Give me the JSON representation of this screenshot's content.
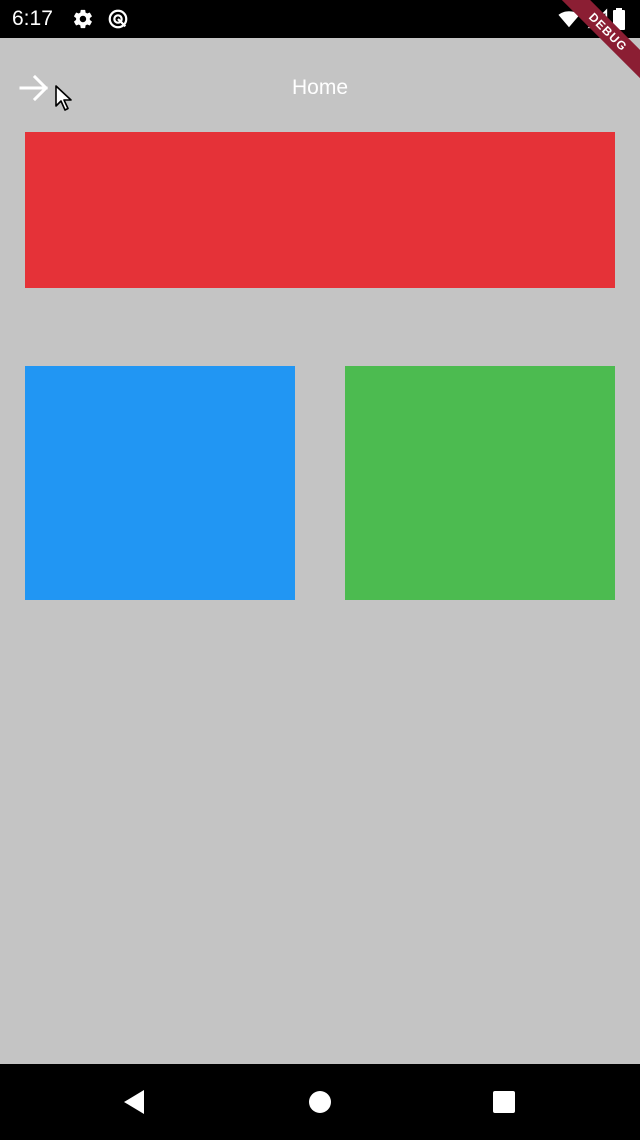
{
  "status_bar": {
    "time": "6:17",
    "icons": [
      "settings-icon",
      "sync-icon",
      "wifi-icon",
      "signal-icon",
      "battery-icon"
    ]
  },
  "debug_banner": {
    "label": "DEBUG"
  },
  "app_bar": {
    "title": "Home",
    "leading_icon": "arrow-right-icon"
  },
  "blocks": [
    {
      "name": "red-block",
      "color": "#e53238"
    },
    {
      "name": "blue-block",
      "color": "#2196f3"
    },
    {
      "name": "green-block",
      "color": "#4cbb50"
    }
  ],
  "nav_bar": {
    "icons": [
      "back-icon",
      "home-icon",
      "recents-icon"
    ]
  },
  "colors": {
    "background": "#c4c4c4",
    "status_bar": "#000000",
    "debug_banner": "#8b1e33"
  }
}
